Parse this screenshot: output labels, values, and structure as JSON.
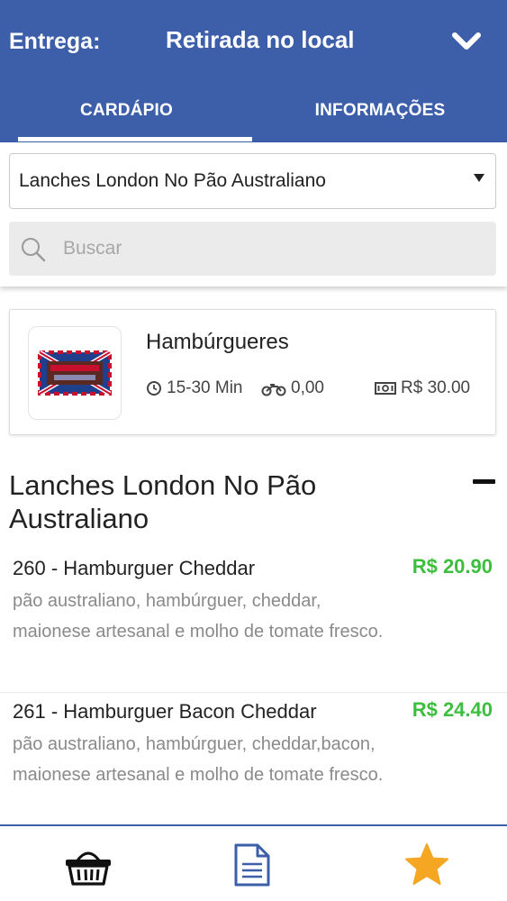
{
  "header": {
    "delivery_label": "Entrega:",
    "delivery_value": "Retirada no local",
    "dropdown_icon": "chevron-down-icon",
    "background_color": "#3d5faa"
  },
  "tabs": [
    {
      "label": "CARDÁPIO",
      "active": true
    },
    {
      "label": "INFORMAÇÕES",
      "active": false
    }
  ],
  "filters": {
    "category_select_value": "Lanches London No Pão Australiano",
    "search_placeholder": "Buscar"
  },
  "store": {
    "name": "Hambúrgueres",
    "delivery_time": "15-30 Min",
    "delivery_fee": "0,00",
    "min_order": "R$ 30.00",
    "icons": [
      "clock-icon",
      "motorcycle-icon",
      "money-icon"
    ]
  },
  "category": {
    "title": "Lanches London No Pão Australiano",
    "toggle_icon": "minus-icon"
  },
  "products": [
    {
      "name": "260 - Hamburguer Cheddar",
      "price": "R$ 20.90",
      "description": "pão australiano, hambúrguer, cheddar, maionese artesanal e molho de tomate fresco."
    },
    {
      "name": "261 - Hamburguer Bacon Cheddar",
      "price": "R$ 24.40",
      "description": "pão australiano, hambúrguer, cheddar,bacon, maionese artesanal e molho de tomate fresco."
    }
  ],
  "colors": {
    "price": "#3cbf3c",
    "accent": "#3d5faa",
    "favorite": "#f5a623"
  },
  "bottom_nav": [
    {
      "icon": "basket-icon"
    },
    {
      "icon": "document-icon"
    },
    {
      "icon": "star-icon"
    }
  ]
}
